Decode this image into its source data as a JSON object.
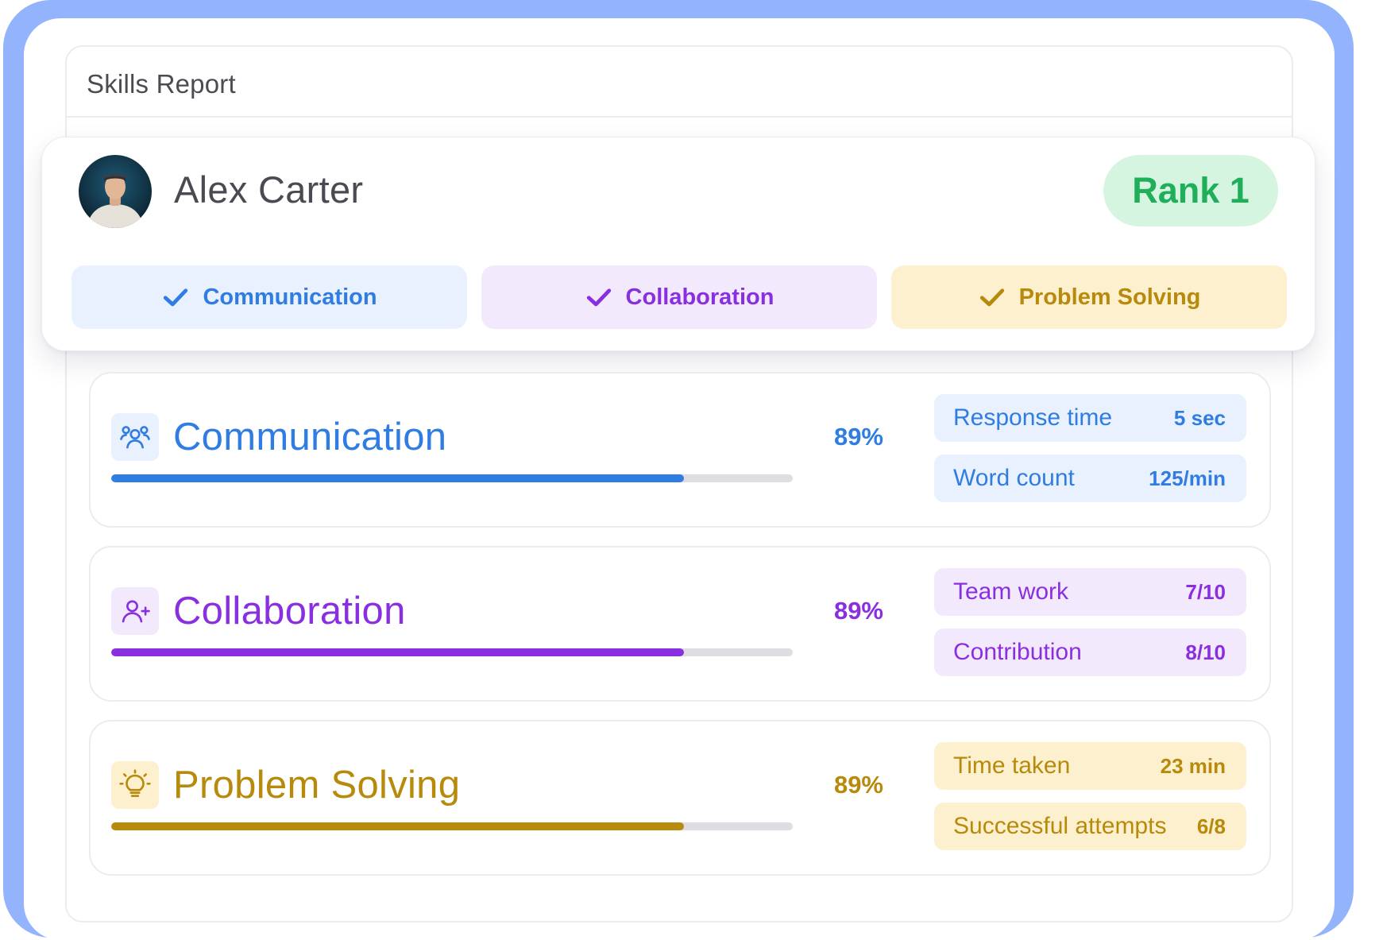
{
  "report": {
    "title": "Skills Report"
  },
  "profile": {
    "name": "Alex Carter",
    "rank": "Rank 1",
    "chips": [
      {
        "label": "Communication",
        "icon": "check-icon",
        "color": "#2f7ce3"
      },
      {
        "label": "Collaboration",
        "icon": "check-icon",
        "color": "#8a2fdf"
      },
      {
        "label": "Problem Solving",
        "icon": "check-icon",
        "color": "#b78a0c"
      }
    ]
  },
  "skills": [
    {
      "name": "Communication",
      "icon": "people-group-icon",
      "percent": "89%",
      "progress": 0.84,
      "color": "#2f7ce3",
      "metrics": [
        {
          "label": "Response time",
          "value": "5 sec"
        },
        {
          "label": "Word count",
          "value": "125/min"
        }
      ]
    },
    {
      "name": "Collaboration",
      "icon": "add-user-icon",
      "percent": "89%",
      "progress": 0.84,
      "color": "#8a2fdf",
      "metrics": [
        {
          "label": "Team work",
          "value": "7/10"
        },
        {
          "label": "Contribution",
          "value": "8/10"
        }
      ]
    },
    {
      "name": "Problem Solving",
      "icon": "lightbulb-icon",
      "percent": "89%",
      "progress": 0.84,
      "color": "#b78a0c",
      "metrics": [
        {
          "label": "Time taken",
          "value": "23 min"
        },
        {
          "label": "Successful attempts",
          "value": "6/8"
        }
      ]
    }
  ]
}
